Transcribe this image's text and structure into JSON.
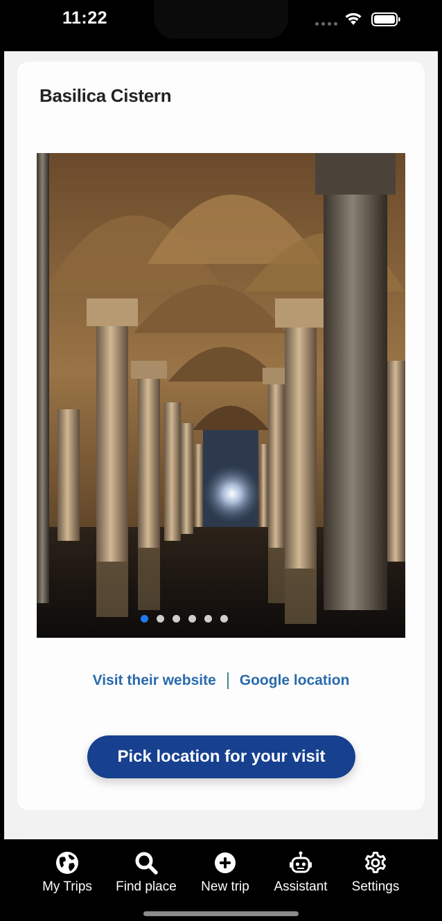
{
  "status": {
    "time": "11:22"
  },
  "place": {
    "title": "Basilica Cistern",
    "photo_count": 6,
    "active_photo": 1
  },
  "links": {
    "website": "Visit their website",
    "location": "Google location"
  },
  "actions": {
    "pick_location": "Pick location for your visit"
  },
  "tabs": [
    {
      "label": "My Trips",
      "icon": "globe-icon"
    },
    {
      "label": "Find place",
      "icon": "search-icon"
    },
    {
      "label": "New trip",
      "icon": "plus-circle-icon"
    },
    {
      "label": "Assistant",
      "icon": "robot-icon"
    },
    {
      "label": "Settings",
      "icon": "gear-icon"
    }
  ],
  "colors": {
    "primary": "#17408f",
    "link": "#2a6aac",
    "dot_active": "#1f7af2"
  }
}
